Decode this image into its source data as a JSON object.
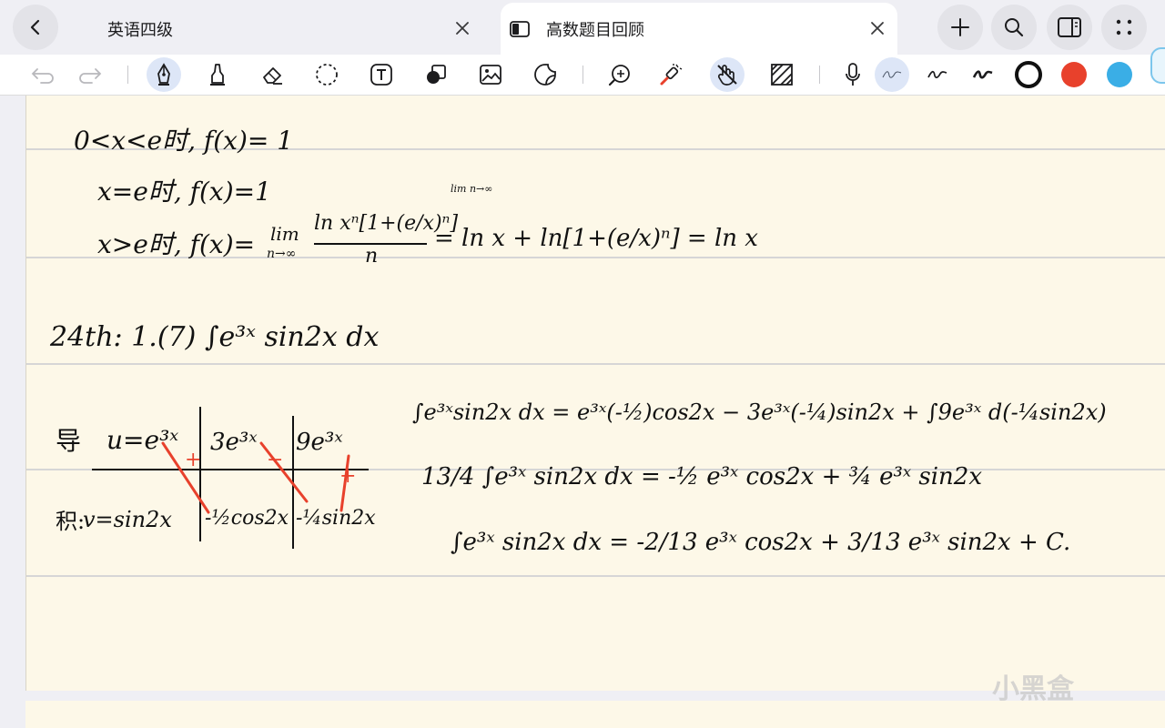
{
  "tabs": [
    {
      "title": "英语四级",
      "active": false
    },
    {
      "title": "高数题目回顾",
      "active": true
    }
  ],
  "toolbar": {
    "tools": [
      "undo-icon",
      "redo-icon",
      "fountain-pen-icon",
      "highlighter-icon",
      "eraser-icon",
      "lasso-icon",
      "text-box-icon",
      "shapes-icon",
      "image-icon",
      "sticker-icon",
      "zoom-icon",
      "laser-pointer-icon",
      "hand-draw-icon",
      "pattern-icon",
      "microphone-icon"
    ],
    "selected_tool": "fountain-pen-icon",
    "pen_colors": [
      "#111111",
      "#e8412c",
      "#3aaee6"
    ],
    "selected_color": "#111111"
  },
  "notes": {
    "line1": "0<x<e时, f(x)= 1",
    "line2": "x=e时, f(x)=1",
    "line3_prefix": "x>e时, f(x)=",
    "lim_label": "lim",
    "lim_sub": "n→∞",
    "line3_numerator": "ln xⁿ[1+(e/x)ⁿ]",
    "line3_denominator": "n",
    "line3_result": "= ln x + ln[1+(e/x)ⁿ] = ln x",
    "lim_small": "lim n→∞",
    "problem": "24th: 1.(7) ∫e³ˣ sin2x dx",
    "table": {
      "row1_label": "导",
      "row2_label": "积:",
      "u": "u=e³ˣ",
      "du1": "3e³ˣ",
      "du2": "9e³ˣ",
      "v": "v=sin2x",
      "v1": "-½cos2x",
      "v2": "-¼sin2x",
      "sign_plus": "+",
      "sign_minus": "−",
      "sign_plus2": "+"
    },
    "eq1": "∫e³ˣsin2x dx = e³ˣ(-½)cos2x − 3e³ˣ(-¼)sin2x + ∫9e³ˣ d(-¼sin2x)",
    "eq2": "13/4 ∫e³ˣ sin2x dx = -½ e³ˣ cos2x + ¾ e³ˣ sin2x",
    "eq3": "∫e³ˣ sin2x dx = -2/13 e³ˣ cos2x + 3/13 e³ˣ sin2x + C."
  },
  "watermark": "小黑盒"
}
